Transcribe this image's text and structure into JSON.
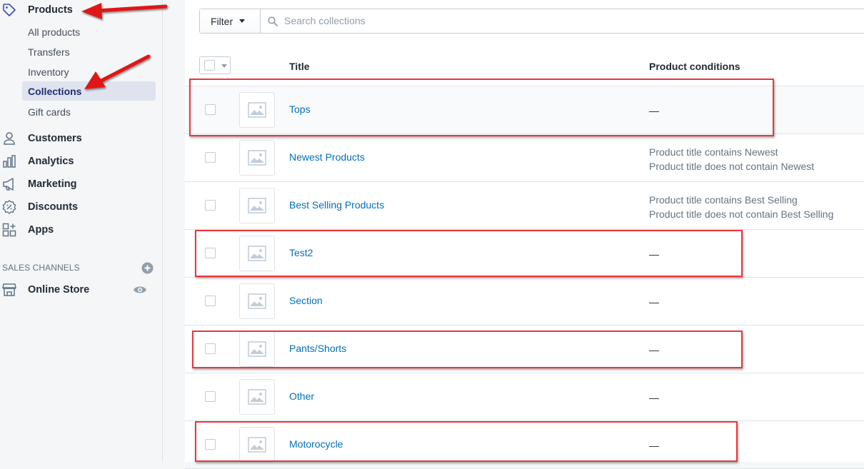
{
  "sidebar": {
    "products": "Products",
    "sub_items": [
      "All products",
      "Transfers",
      "Inventory",
      "Collections",
      "Gift cards"
    ],
    "active_sub": "Collections",
    "customers": "Customers",
    "analytics": "Analytics",
    "marketing": "Marketing",
    "discounts": "Discounts",
    "apps": "Apps",
    "sales_channels": "SALES CHANNELS",
    "online_store": "Online Store"
  },
  "filter": {
    "label": "Filter",
    "search_placeholder": "Search collections"
  },
  "table": {
    "headers": {
      "title": "Title",
      "conditions": "Product conditions"
    },
    "rows": [
      {
        "title": "Tops",
        "conditions": [
          "—"
        ]
      },
      {
        "title": "Newest Products",
        "conditions": [
          "Product title contains Newest",
          "Product title does not contain Newest"
        ]
      },
      {
        "title": "Best Selling Products",
        "conditions": [
          "Product title contains Best Selling",
          "Product title does not contain Best Selling"
        ]
      },
      {
        "title": "Test2",
        "conditions": [
          "—"
        ]
      },
      {
        "title": "Section",
        "conditions": [
          "—"
        ]
      },
      {
        "title": "Pants/Shorts",
        "conditions": [
          "—"
        ]
      },
      {
        "title": "Other",
        "conditions": [
          "—"
        ]
      },
      {
        "title": "Motorocycle",
        "conditions": [
          "—"
        ]
      }
    ]
  },
  "colors": {
    "accent_link": "#006fbb",
    "active_nav": "#202e78",
    "annotation_red": "#e8383d"
  },
  "icons": [
    "tag-icon",
    "person-icon",
    "bar-chart-icon",
    "megaphone-icon",
    "discount-badge-icon",
    "apps-grid-icon",
    "plus-circle-icon",
    "store-icon",
    "eye-icon",
    "search-icon",
    "image-placeholder-icon"
  ]
}
